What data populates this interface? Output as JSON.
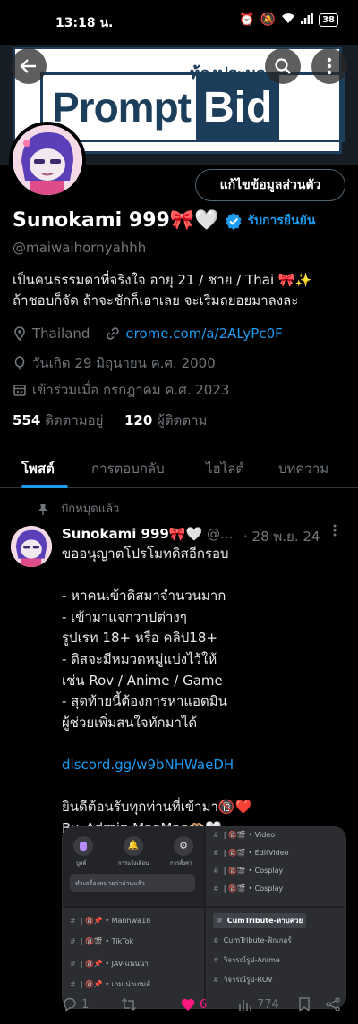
{
  "status_bar": {
    "time": "13:18 น.",
    "battery": "38"
  },
  "banner": {
    "logo_word_1": "Prompt",
    "logo_word_2": "Bid",
    "overlay_text": "ห้องประมูล"
  },
  "profile": {
    "edit_button_label": "แก้ไขข้อมูลส่วนตัว",
    "display_name": "Sunokami 999🎀🤍",
    "verify_label": "รับการยืนยัน",
    "handle": "@maiwaihornyahhh",
    "bio_line_1": "เป็นคนธรรมดาที่จริงใจ อายุ 21 / ชาย / Thai 🎀✨",
    "bio_line_2": "ถ้าชอบก็จัด ถ้าจะชักก็เอาเลย จะเริ่มถยอยมาลงละ",
    "location": "Thailand",
    "website": "erome.com/a/2ALyPc0F",
    "birthday": "วันเกิด 29 มิถุนายน ค.ศ. 2000",
    "joined": "เข้าร่วมเมื่อ กรกฎาคม ค.ศ. 2023",
    "following_count": "554",
    "following_label": "ติดตามอยู่",
    "followers_count": "120",
    "followers_label": "ผู้ติดตาม"
  },
  "tabs": [
    {
      "label": "โพสต์",
      "active": true
    },
    {
      "label": "การตอบกลับ",
      "active": false
    },
    {
      "label": "ไฮไลต์",
      "active": false
    },
    {
      "label": "บทความ",
      "active": false
    }
  ],
  "pinned_post": {
    "pinned_label": "ปักหมุดแล้ว",
    "author_name": "Sunokami 999🎀🤍",
    "author_handle": "@...",
    "date": "· 28 พ.ย. 24",
    "text": "ขออนุญาตโปรโมทดิสอีกรอบ\n\n- หาคนเข้าดิสมาจำนวนมาก\n- เข้ามาแจกวาปต่างๆ\nรูปเรท 18+ หรือ คลิป18+\n- ดิสจะมีหมวดหมู่แบ่งไว้ให้\nเช่น Rov / Anime / Game\n- สุดท้ายนี้ต้องการหาแอดมิน\nผู้ช่วยเพิ่มสนใจทักมาได้",
    "link": "discord.gg/w9bNHWaeDH",
    "text_2": "ยินดีต้อนรับทุกท่านที่เข้ามา🔞❤️\nBy. Admin MaoMao🫶🏼🤍",
    "image": {
      "top_left_icons": [
        "บูสต์",
        "การแจ้งเตือน",
        "การตั้งค่า"
      ],
      "search_placeholder": "ทำเครื่องหมายว่าอ่านแล้ว",
      "top_right_channels": [
        "Video",
        "EditVideo",
        "Cosplay",
        "Cosplay"
      ],
      "bottom_left_channels": [
        "Manhwa18",
        "TikTok",
        "JAV-แนนน่า",
        "เกมเน่าเกมส์"
      ],
      "bottom_right_channels": [
        "CumTribute-หาบควย",
        "CumTribute-ฟิกเกอร์",
        "วิจารณ์รูป-Anime",
        "วิจารณ์รูป-ROV"
      ]
    },
    "replies": "1",
    "likes": "6",
    "views": "774"
  },
  "colors": {
    "accent": "#1d9bf0",
    "like": "#f91880",
    "muted": "#71767b",
    "banner_navy": "#1d3e5a"
  }
}
